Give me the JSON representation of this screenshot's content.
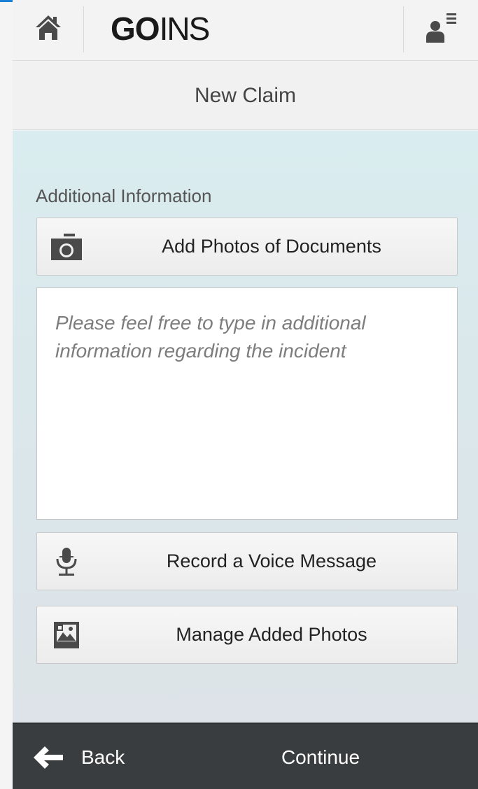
{
  "header": {
    "logo_bold": "GO",
    "logo_light": "INS",
    "home_icon": "home-icon",
    "profile_icon": "user-menu-icon"
  },
  "title_bar": {
    "title": "New Claim"
  },
  "main": {
    "section_label": "Additional Information",
    "add_photos_button": {
      "label": "Add Photos of Documents",
      "icon": "camera-icon"
    },
    "additional_info_field": {
      "value": "",
      "placeholder": "Please feel free to type in additional information regarding the incident"
    },
    "record_voice_button": {
      "label": "Record a Voice Message",
      "icon": "microphone-icon"
    },
    "manage_photos_button": {
      "label": "Manage Added Photos",
      "icon": "photo-gallery-icon"
    }
  },
  "footer": {
    "back_label": "Back",
    "back_icon": "arrow-left-icon",
    "continue_label": "Continue"
  },
  "colors": {
    "accent_top": "#1a7fd6",
    "content_background": "#d9ecef",
    "footer_background": "#3a3d40",
    "icon_gray": "#4a4a4a"
  }
}
